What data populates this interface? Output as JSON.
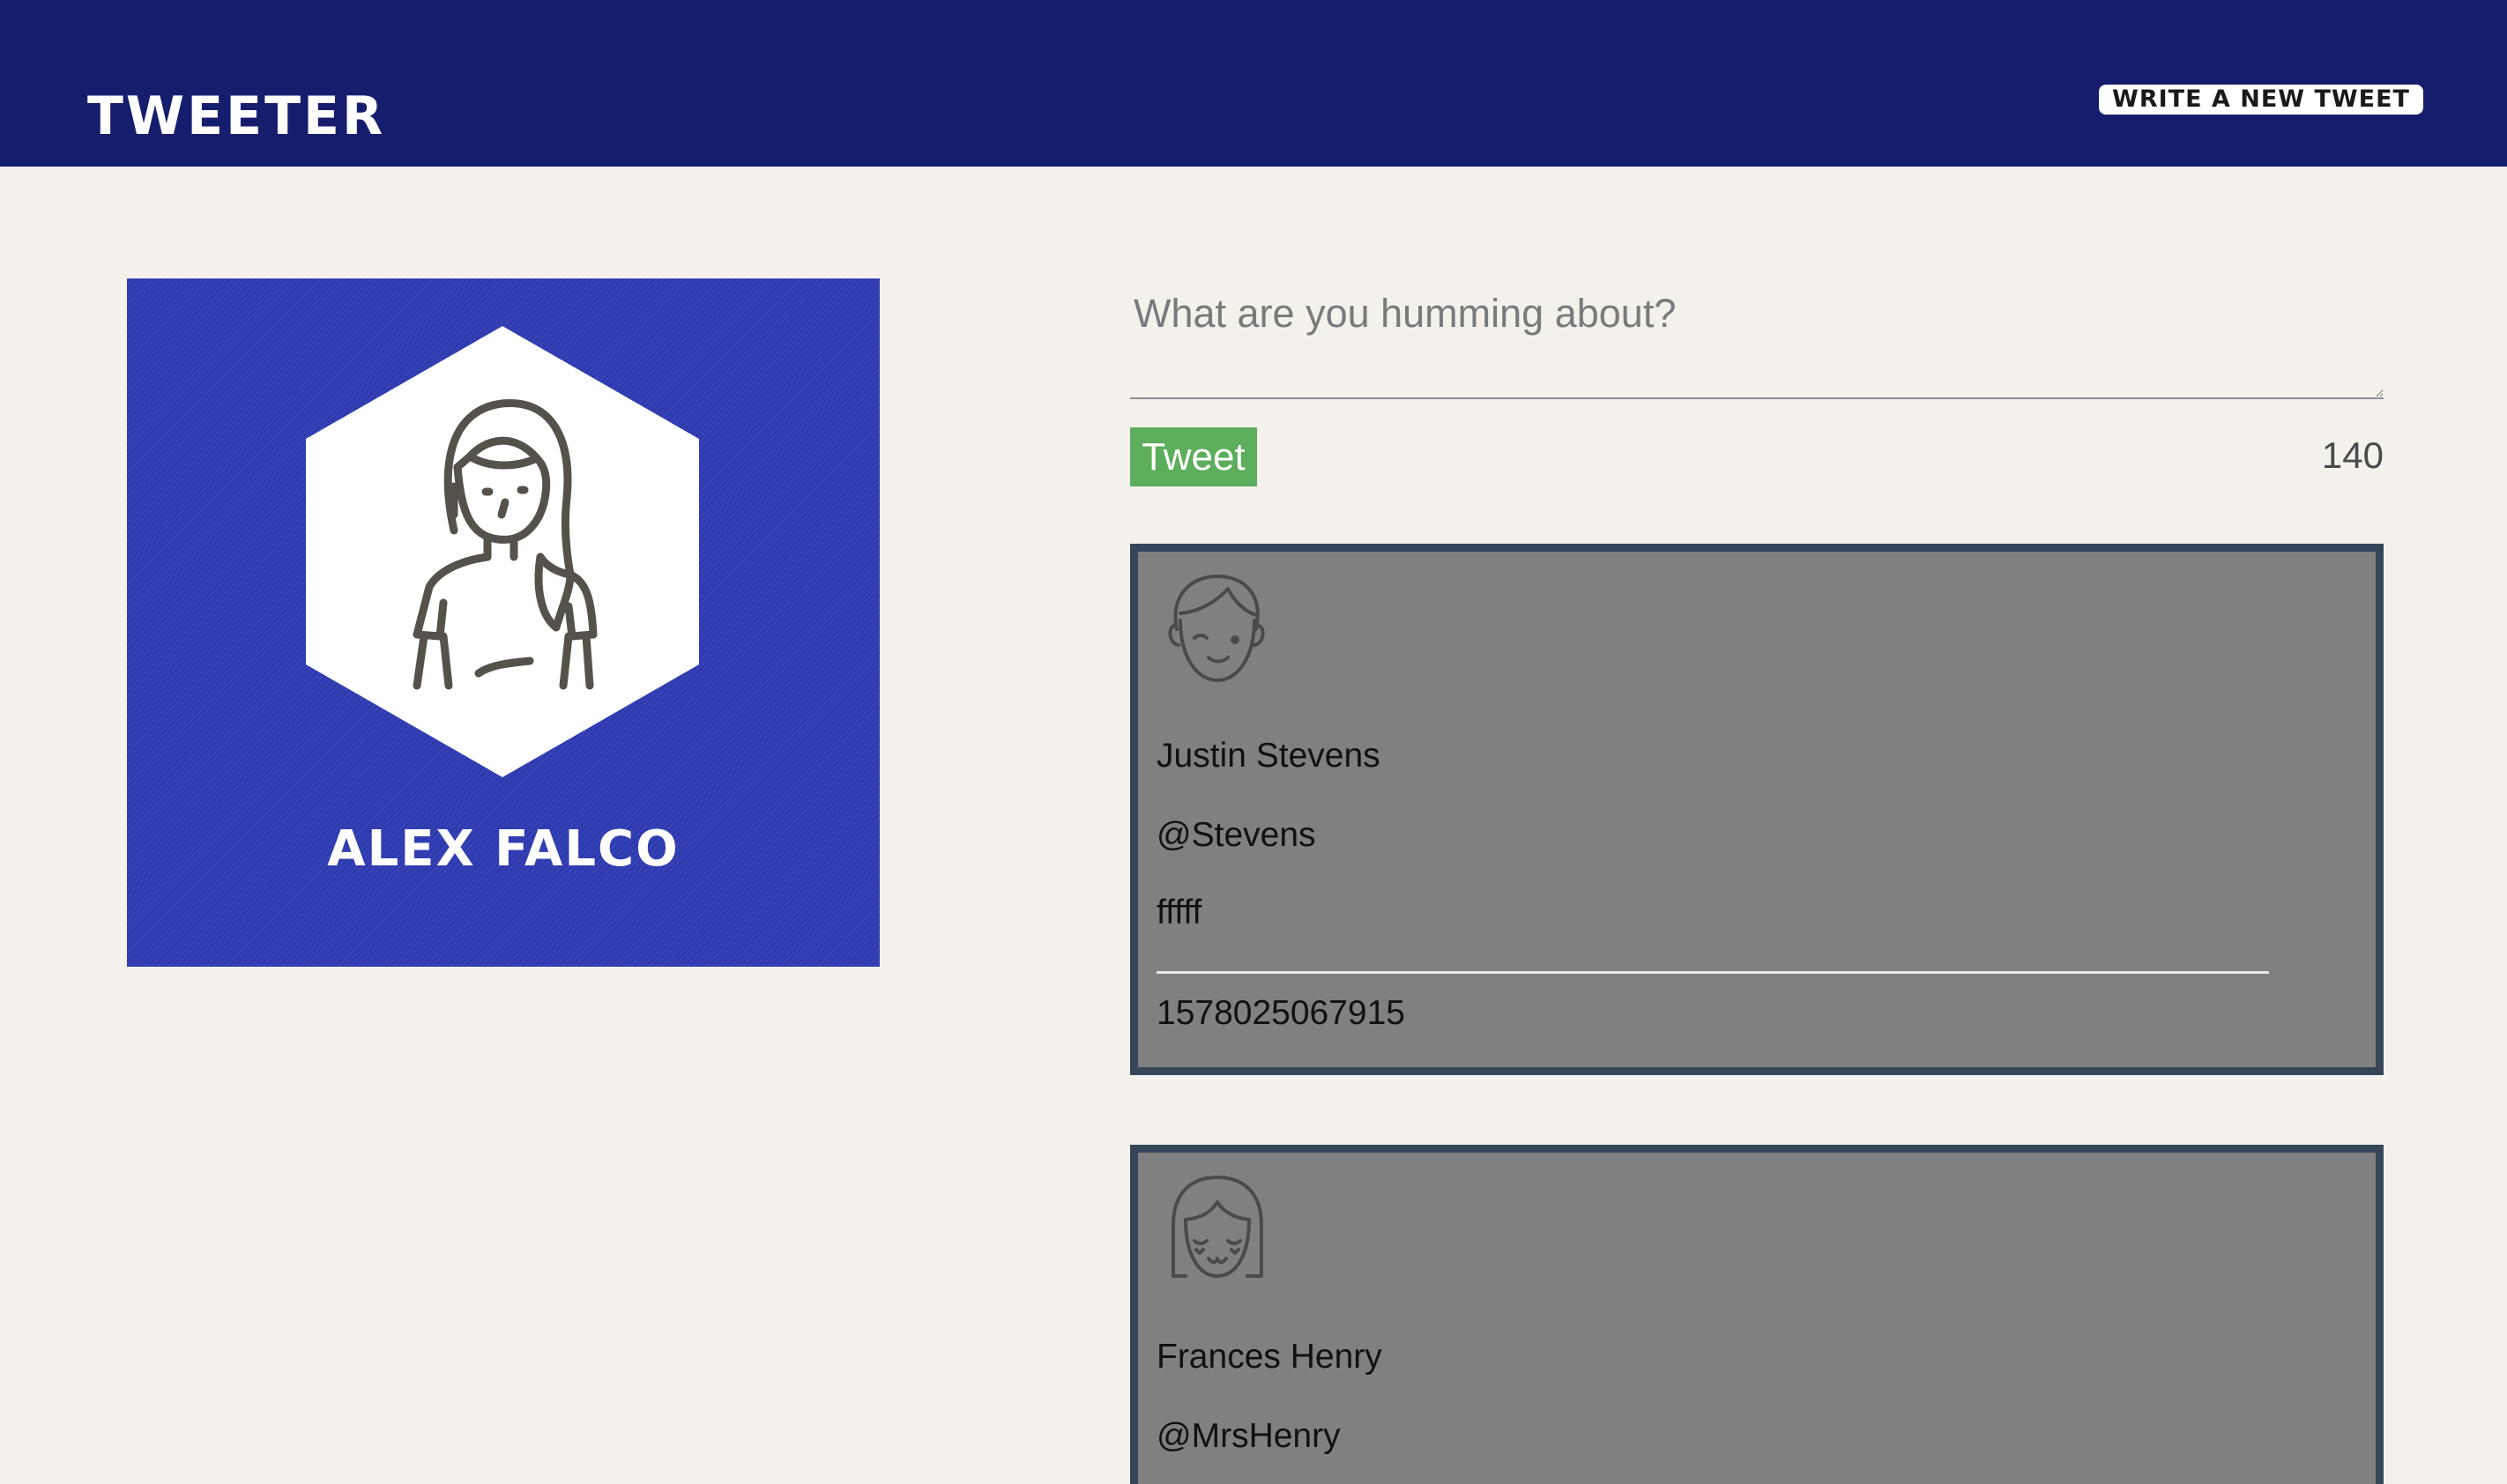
{
  "header": {
    "brand": "TWEETER",
    "compose_button_label": "WRITE A NEW TWEET"
  },
  "profile": {
    "name": "ALEX FALCO",
    "avatar_icon": "woman-avatar-icon"
  },
  "compose": {
    "placeholder": "What are you humming about?",
    "tweet_button_label": "Tweet",
    "char_counter": "140"
  },
  "tweets": [
    {
      "avatar_icon": "boy-avatar-icon",
      "name": "Justin Stevens",
      "handle": "@Stevens",
      "content": "fffff",
      "timestamp": "1578025067915"
    },
    {
      "avatar_icon": "girl-avatar-icon",
      "name": "Frances Henry",
      "handle": "@MrsHenry"
    }
  ],
  "colors": {
    "header_bg": "#171d6d",
    "page_bg": "#f4f1ed",
    "profile_card_bg": "#2f3cb3",
    "tweet_button_bg": "#5cad5c",
    "tweet_card_bg": "#808080",
    "tweet_card_border": "#374559"
  }
}
